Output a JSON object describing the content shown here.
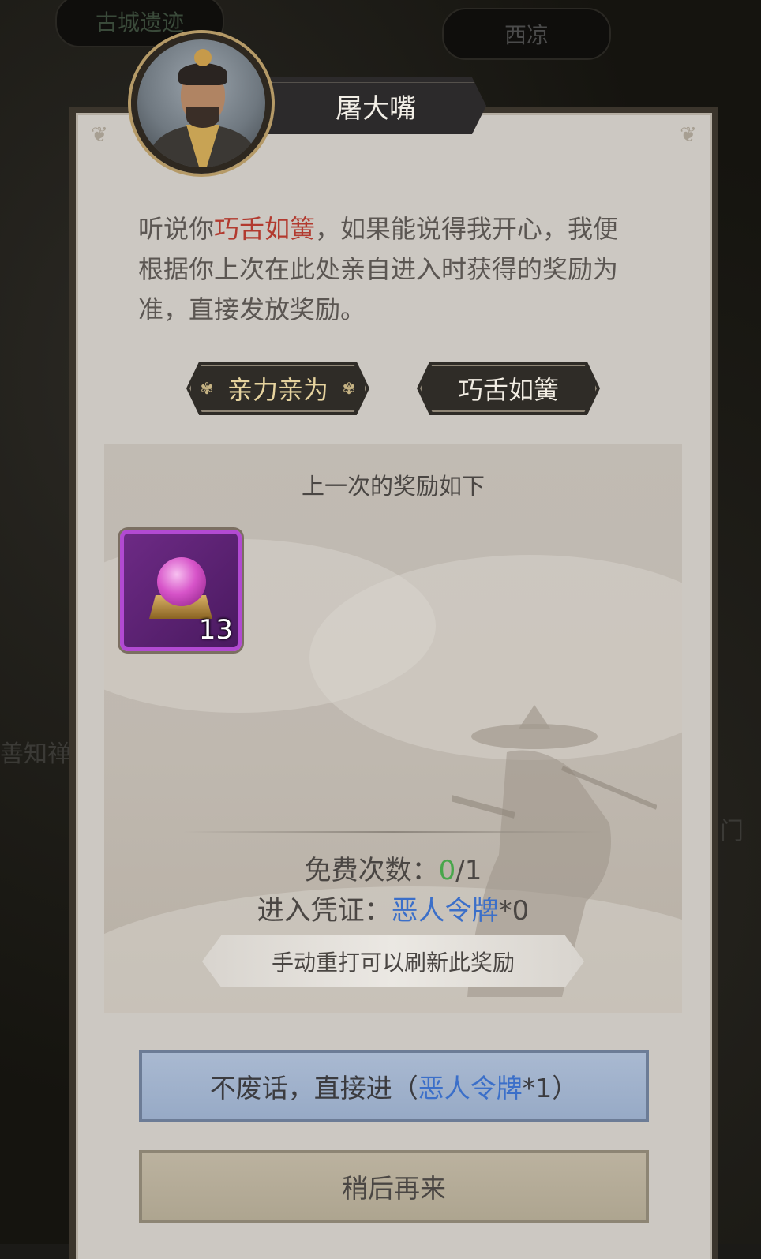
{
  "background": {
    "tag_left": "古城遗迹",
    "tag_right": "西凉",
    "side_left": "善知禅院",
    "side_right": "门"
  },
  "npc": {
    "name": "屠大嘴",
    "avatar_icon": "npc-portrait"
  },
  "dialog": {
    "text_before": "听说你",
    "highlight": "巧舌如簧",
    "text_after": "，如果能说得我开心，我便根据你上次在此处亲自进入时获得的奖励为准，直接发放奖励。",
    "highlight_color": "#b23a2f"
  },
  "choices": {
    "personal": "亲力亲为",
    "talk": "巧舌如簧"
  },
  "reward": {
    "title": "上一次的奖励如下",
    "item": {
      "icon": "purple-orb-chest-icon",
      "count": "13"
    },
    "free_label": "免费次数：",
    "free_used": "0",
    "free_total": "/1",
    "ticket_label": "进入凭证：",
    "ticket_name": "恶人令牌",
    "ticket_count": "*0",
    "hint": "手动重打可以刷新此奖励"
  },
  "actions": {
    "enter_prefix": "不废话，直接进（",
    "enter_ticket": "恶人令牌",
    "enter_suffix": "*1）",
    "later": "稍后再来"
  },
  "colors": {
    "green": "#48a64b",
    "blue": "#3b6fc9",
    "panel": "#ccc8c2"
  }
}
